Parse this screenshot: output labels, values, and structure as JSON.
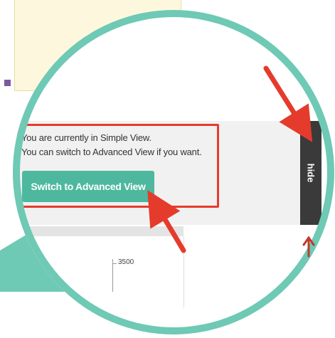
{
  "notice": {
    "line1": "You are currently in Simple View.",
    "line2": "You can switch to Advanced View if you want."
  },
  "advanced_button_label": "Switch to Advanced View",
  "hide_tab_label": "hide",
  "chart": {
    "y_tick_label": "3500"
  },
  "colors": {
    "accent_teal": "#4db89e",
    "ring_teal": "#6ec9b5",
    "annotation_red": "#e53b2c",
    "hide_tab": "#3a3a3a"
  }
}
